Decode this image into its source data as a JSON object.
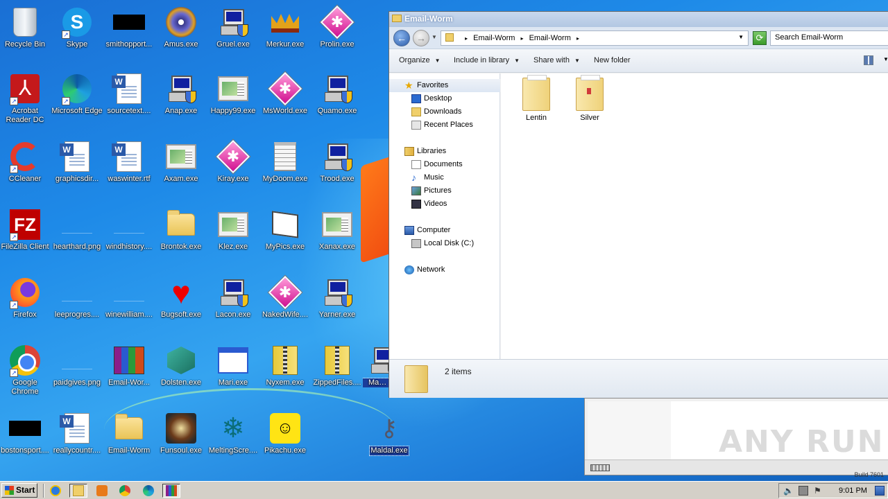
{
  "desktop": {
    "icons": [
      {
        "label": "Recycle Bin",
        "icon": "recycle-bin-icon"
      },
      {
        "label": "Skype",
        "icon": "skype-icon"
      },
      {
        "label": "smithopport...",
        "icon": "black-image-icon"
      },
      {
        "label": "Amus.exe",
        "icon": "disc-icon"
      },
      {
        "label": "Gruel.exe",
        "icon": "computer-shield-icon"
      },
      {
        "label": "Merkur.exe",
        "icon": "crown-icon"
      },
      {
        "label": "Prolin.exe",
        "icon": "pink-diamond-icon"
      },
      {
        "label": "Acrobat Reader DC",
        "icon": "acrobat-icon"
      },
      {
        "label": "Microsoft Edge",
        "icon": "edge-icon"
      },
      {
        "label": "sourcetext....",
        "icon": "word-doc-icon"
      },
      {
        "label": "Anap.exe",
        "icon": "computer-shield-icon"
      },
      {
        "label": "Happy99.exe",
        "icon": "window-icon"
      },
      {
        "label": "MsWorld.exe",
        "icon": "pink-diamond-icon"
      },
      {
        "label": "Quamo.exe",
        "icon": "computer-shield-icon"
      },
      {
        "label": "CCleaner",
        "icon": "ccleaner-icon"
      },
      {
        "label": "graphicsdir...",
        "icon": "word-doc-icon"
      },
      {
        "label": "waswinter.rtf",
        "icon": "word-doc-icon"
      },
      {
        "label": "Axam.exe",
        "icon": "window-icon"
      },
      {
        "label": "Kiray.exe",
        "icon": "pink-diamond-icon"
      },
      {
        "label": "MyDoom.exe",
        "icon": "notepad-icon"
      },
      {
        "label": "Trood.exe",
        "icon": "computer-shield-icon"
      },
      {
        "label": "FileZilla Client",
        "icon": "filezilla-icon"
      },
      {
        "label": "hearthard.png",
        "icon": "blank-image-icon"
      },
      {
        "label": "windhistory....",
        "icon": "blank-image-icon"
      },
      {
        "label": "Brontok.exe",
        "icon": "folder-icon"
      },
      {
        "label": "Klez.exe",
        "icon": "window-icon"
      },
      {
        "label": "MyPics.exe",
        "icon": "mypics-icon"
      },
      {
        "label": "Xanax.exe",
        "icon": "window-icon"
      },
      {
        "label": "Firefox",
        "icon": "firefox-icon"
      },
      {
        "label": "leeprogres....",
        "icon": "blank-image-icon"
      },
      {
        "label": "winewilliam....",
        "icon": "blank-image-icon"
      },
      {
        "label": "Bugsoft.exe",
        "icon": "heart-icon"
      },
      {
        "label": "Lacon.exe",
        "icon": "computer-shield-icon"
      },
      {
        "label": "NakedWife....",
        "icon": "pink-diamond-icon"
      },
      {
        "label": "Yarner.exe",
        "icon": "computer-shield-icon"
      },
      {
        "label": "Google Chrome",
        "icon": "chrome-icon"
      },
      {
        "label": "paidgives.png",
        "icon": "blank-image-icon"
      },
      {
        "label": "Email-Wor...",
        "icon": "winrar-icon"
      },
      {
        "label": "Dolsten.exe",
        "icon": "cubes-icon"
      },
      {
        "label": "Mari.exe",
        "icon": "app-window-icon"
      },
      {
        "label": "Nyxem.exe",
        "icon": "zip-folder-icon"
      },
      {
        "label": "ZippedFiles....",
        "icon": "zip-folder-icon"
      },
      {
        "label": "Magis",
        "icon": "computer-shield-icon"
      },
      {
        "label": "bostonsport....",
        "icon": "black-image-icon"
      },
      {
        "label": "reallycountr....",
        "icon": "word-doc-icon"
      },
      {
        "label": "Email-Worm",
        "icon": "folder-icon"
      },
      {
        "label": "Funsoul.exe",
        "icon": "flowers-icon"
      },
      {
        "label": "MeltingScre....",
        "icon": "snowflake-icon"
      },
      {
        "label": "Pikachu.exe",
        "icon": "pikachu-icon"
      },
      {
        "label": "Maldal.exe",
        "icon": "keys-icon"
      }
    ]
  },
  "explorer": {
    "title": "Email-Worm",
    "address": {
      "segment1": "Email-Worm",
      "segment2": "Email-Worm"
    },
    "search_placeholder": "Search Email-Worm",
    "toolbar": {
      "organize": "Organize",
      "include": "Include in library",
      "share": "Share with",
      "new_folder": "New folder"
    },
    "nav": {
      "favorites": "Favorites",
      "desktop": "Desktop",
      "downloads": "Downloads",
      "recent": "Recent Places",
      "libraries": "Libraries",
      "documents": "Documents",
      "music": "Music",
      "pictures": "Pictures",
      "videos": "Videos",
      "computer": "Computer",
      "local_disk": "Local Disk (C:)",
      "network": "Network"
    },
    "files": [
      {
        "name": "Lentin"
      },
      {
        "name": "Silver"
      }
    ],
    "status": "2 items"
  },
  "watermark": "ANY RUN",
  "build_text": "Build 7601",
  "taskbar": {
    "start_label": "Start",
    "clock": "9:01 PM"
  }
}
